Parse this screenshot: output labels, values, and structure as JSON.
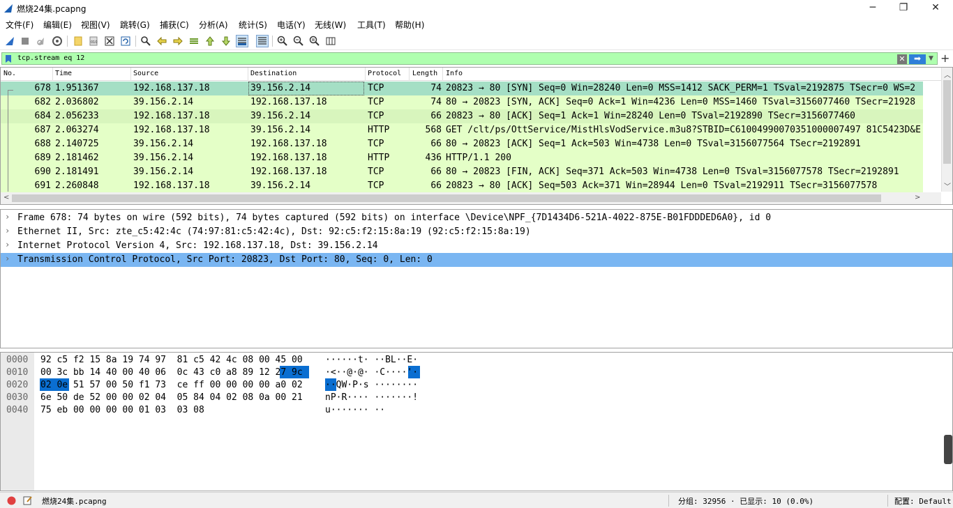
{
  "window": {
    "title": "燃烧24集.pcapng",
    "minimize": "─",
    "restore": "❐",
    "close": "✕"
  },
  "menu": [
    "文件(F)",
    "编辑(E)",
    "视图(V)",
    "跳转(G)",
    "捕获(C)",
    "分析(A)",
    "统计(S)",
    "电话(Y)",
    "无线(W)",
    "工具(T)",
    "帮助(H)"
  ],
  "toolbar": {
    "icons": [
      "shark-start-icon",
      "stop-icon",
      "restart-icon",
      "options-gear-icon",
      "open-file-icon",
      "save-file-icon",
      "close-file-icon",
      "reload-icon",
      "find-icon",
      "back-arrow-icon",
      "forward-arrow-icon",
      "goto-packet-icon",
      "first-packet-icon",
      "last-packet-icon",
      "autoscroll-icon",
      "colorize-icon",
      "zoom-in-icon",
      "zoom-out-icon",
      "zoom-normal-icon",
      "resize-columns-icon"
    ]
  },
  "filter": {
    "value": "tcp.stream eq 12",
    "clear": "✕",
    "apply": "➡",
    "dropdown": "▼",
    "add": "+",
    "color": "#afffaf"
  },
  "packet_list": {
    "columns": [
      "No.",
      "Time",
      "Source",
      "Destination",
      "Protocol",
      "Length",
      "Info"
    ],
    "rows": [
      {
        "no": "678",
        "time": "1.951367",
        "src": "192.168.137.18",
        "dst": "39.156.2.14",
        "proto": "TCP",
        "len": "74",
        "info": "20823 → 80 [SYN] Seq=0 Win=28240 Len=0 MSS=1412 SACK_PERM=1 TSval=2192875 TSecr=0 WS=2",
        "state": "selected"
      },
      {
        "no": "682",
        "time": "2.036802",
        "src": "39.156.2.14",
        "dst": "192.168.137.18",
        "proto": "TCP",
        "len": "74",
        "info": "80 → 20823 [SYN, ACK] Seq=0 Ack=1 Win=4236 Len=0 MSS=1460 TSval=3156077460 TSecr=21928",
        "state": "normal"
      },
      {
        "no": "684",
        "time": "2.056233",
        "src": "192.168.137.18",
        "dst": "39.156.2.14",
        "proto": "TCP",
        "len": "66",
        "info": "20823 → 80 [ACK] Seq=1 Ack=1 Win=28240 Len=0 TSval=2192890 TSecr=3156077460",
        "state": "stripe"
      },
      {
        "no": "687",
        "time": "2.063274",
        "src": "192.168.137.18",
        "dst": "39.156.2.14",
        "proto": "HTTP",
        "len": "568",
        "info": "GET /clt/ps/OttService/MistHlsVodService.m3u8?STBID=C61004990070351000007497 81C5423D&E",
        "state": "normal"
      },
      {
        "no": "688",
        "time": "2.140725",
        "src": "39.156.2.14",
        "dst": "192.168.137.18",
        "proto": "TCP",
        "len": "66",
        "info": "80 → 20823 [ACK] Seq=1 Ack=503 Win=4738 Len=0 TSval=3156077564 TSecr=2192891",
        "state": "normal"
      },
      {
        "no": "689",
        "time": "2.181462",
        "src": "39.156.2.14",
        "dst": "192.168.137.18",
        "proto": "HTTP",
        "len": "436",
        "info": "HTTP/1.1 200",
        "state": "normal"
      },
      {
        "no": "690",
        "time": "2.181491",
        "src": "39.156.2.14",
        "dst": "192.168.137.18",
        "proto": "TCP",
        "len": "66",
        "info": "80 → 20823 [FIN, ACK] Seq=371 Ack=503 Win=4738 Len=0 TSval=3156077578 TSecr=2192891",
        "state": "normal"
      },
      {
        "no": "691",
        "time": "2.260848",
        "src": "192.168.137.18",
        "dst": "39.156.2.14",
        "proto": "TCP",
        "len": "66",
        "info": "20823 → 80 [ACK] Seq=503 Ack=371 Win=28944 Len=0 TSval=2192911 TSecr=3156077578",
        "state": "normal"
      }
    ]
  },
  "details": [
    {
      "text": "Frame 678: 74 bytes on wire (592 bits), 74 bytes captured (592 bits) on interface \\Device\\NPF_{7D1434D6-521A-4022-875E-B01FDDDED6A0}, id 0",
      "highlighted": false
    },
    {
      "text": "Ethernet II, Src: zte_c5:42:4c (74:97:81:c5:42:4c), Dst: 92:c5:f2:15:8a:19 (92:c5:f2:15:8a:19)",
      "highlighted": false
    },
    {
      "text": "Internet Protocol Version 4, Src: 192.168.137.18, Dst: 39.156.2.14",
      "highlighted": false
    },
    {
      "text": "Transmission Control Protocol, Src Port: 20823, Dst Port: 80, Seq: 0, Len: 0",
      "highlighted": true
    }
  ],
  "bytes": [
    {
      "offset": "0000",
      "hex": "92 c5 f2 15 8a 19 74 97  81 c5 42 4c 08 00 45 00",
      "ascii": "······t· ··BL··E·"
    },
    {
      "offset": "0010",
      "hex": "00 3c bb 14 40 00 40 06  0c 43 c0 a8 89 12 27 9c",
      "ascii": "·<··@·@· ·C····'·"
    },
    {
      "offset": "0020",
      "hex": "02 0e 51 57 00 50 f1 73  ce ff 00 00 00 00 a0 02",
      "ascii": "··QW·P·s ········"
    },
    {
      "offset": "0030",
      "hex": "6e 50 de 52 00 00 02 04  05 84 04 02 08 0a 00 21",
      "ascii": "nP·R···· ·······!"
    },
    {
      "offset": "0040",
      "hex": "75 eb 00 00 00 00 01 03  03 08",
      "ascii": "u······· ··"
    }
  ],
  "status": {
    "file": "燃烧24集.pcapng",
    "packets": "分组: 32956 · 已显示: 10 (0.0%)",
    "profile": "配置: Default"
  }
}
